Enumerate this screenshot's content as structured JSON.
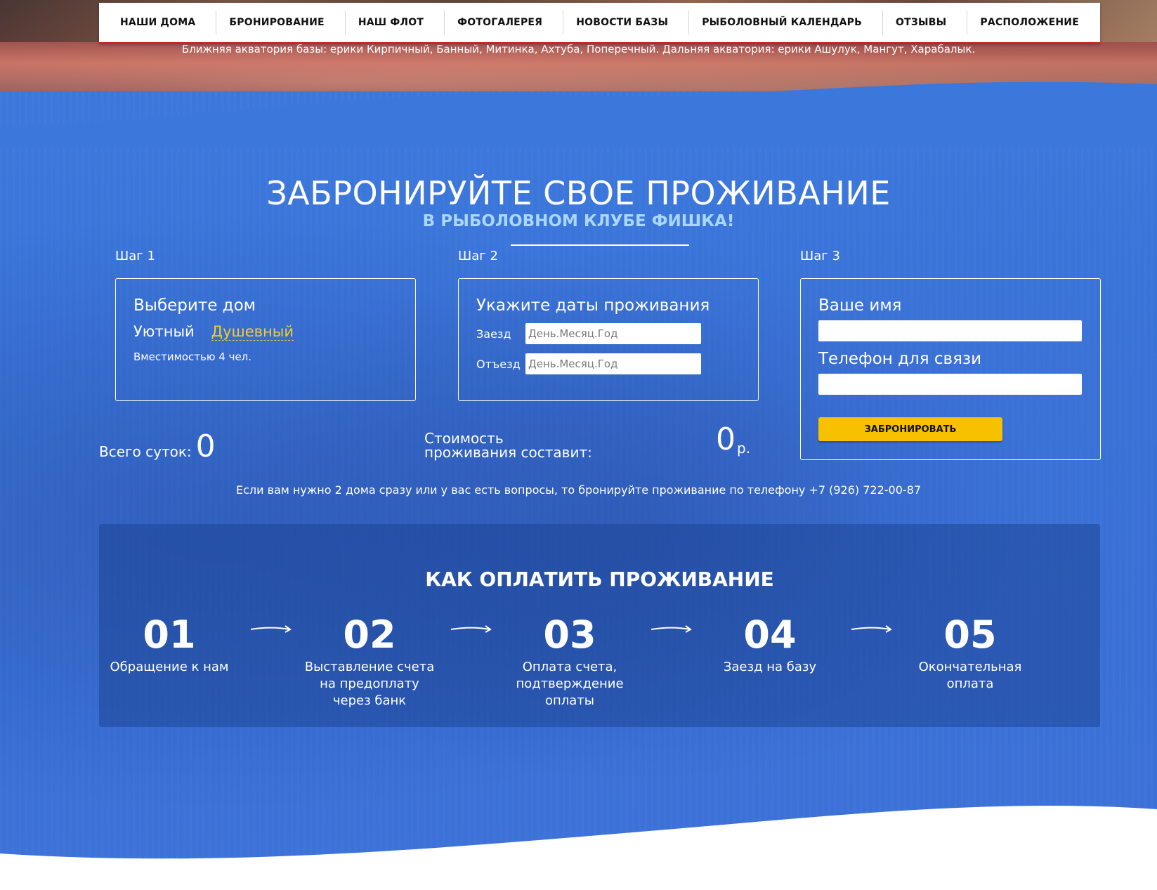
{
  "nav": {
    "items": [
      "НАШИ ДОМА",
      "БРОНИРОВАНИЕ",
      "НАШ ФЛОТ",
      "ФОТОГАЛЕРЕЯ",
      "НОВОСТИ БАЗЫ",
      "РЫБОЛОВНЫЙ КАЛЕНДАРЬ",
      "ОТЗЫВЫ",
      "РАСПОЛОЖЕНИЕ"
    ]
  },
  "waters_text": "Ближняя акватория базы: ерики Кирпичный, Банный, Митинка, Ахтуба, Поперечный. Дальняя акватория: ерики Ашулук, Мангут, Харабалык.",
  "booking": {
    "title": "ЗАБРОНИРУЙТЕ СВОЕ ПРОЖИВАНИЕ",
    "subtitle": "В РЫБОЛОВНОМ КЛУБЕ ФИШКА!",
    "step1": {
      "label": "Шаг 1",
      "heading": "Выберите дом",
      "houses": [
        "Уютный",
        "Душевный"
      ],
      "selected": "Душевный",
      "capacity": "Вместимостью 4 чел."
    },
    "step2": {
      "label": "Шаг 2",
      "heading": "Укажите даты проживания",
      "checkin_label": "Заезд",
      "checkout_label": "Отъезд",
      "date_placeholder": "День.Месяц.Год"
    },
    "step3": {
      "label": "Шаг 3",
      "name_label": "Ваше имя",
      "phone_label": "Телефон для связи",
      "button": "ЗАБРОНИРОВАТЬ"
    },
    "total_days_label": "Всего суток:",
    "total_days": "0",
    "cost_label": "Стоимость проживания составит:",
    "cost": "0",
    "currency": "р.",
    "phone_note": "Если вам нужно 2 дома сразу или у вас есть вопросы, то бронируйте проживание по телефону +7 (926) 722-00-87"
  },
  "payment": {
    "title": "КАК ОПЛАТИТЬ ПРОЖИВАНИЕ",
    "steps": [
      {
        "num": "01",
        "text": "Обращение к нам"
      },
      {
        "num": "02",
        "text": "Выставление счета на предоплату через банк"
      },
      {
        "num": "03",
        "text": "Оплата счета, подтверждение оплаты"
      },
      {
        "num": "04",
        "text": "Заезд на базу"
      },
      {
        "num": "05",
        "text": "Окончательная оплата"
      }
    ]
  },
  "colors": {
    "blue": "#3a73d8",
    "accent_yellow": "#f7c100",
    "nav_border": "#c92424",
    "subtitle": "#a9d7ff"
  }
}
